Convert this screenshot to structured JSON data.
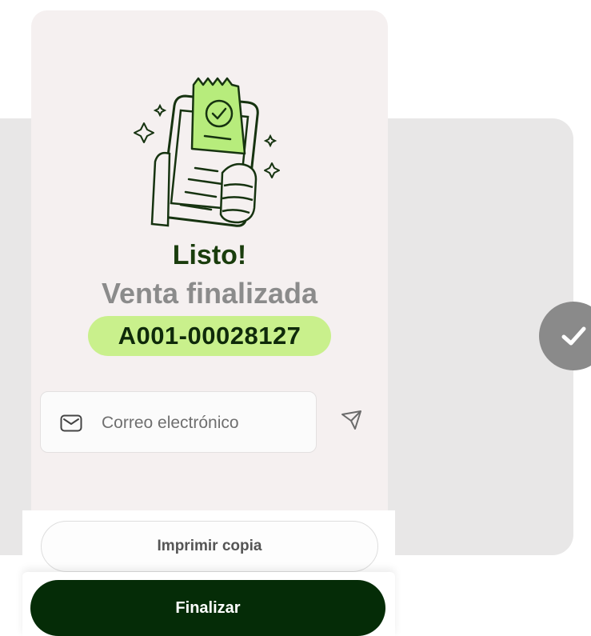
{
  "success": {
    "title": "Listo!",
    "subtitle": "Venta finalizada",
    "receipt_code": "A001-00028127"
  },
  "email": {
    "placeholder": "Correo electrónico",
    "value": ""
  },
  "actions": {
    "print_label": "Imprimir copia",
    "finish_label": "Finalizar"
  },
  "icons": {
    "email": "mail-icon",
    "send": "send-icon",
    "check": "check-icon",
    "illustration": "receipt-terminal-illustration"
  },
  "colors": {
    "accent_green": "#c9f08c",
    "dark_green": "#052c07",
    "title_green": "#1a3d0d"
  }
}
